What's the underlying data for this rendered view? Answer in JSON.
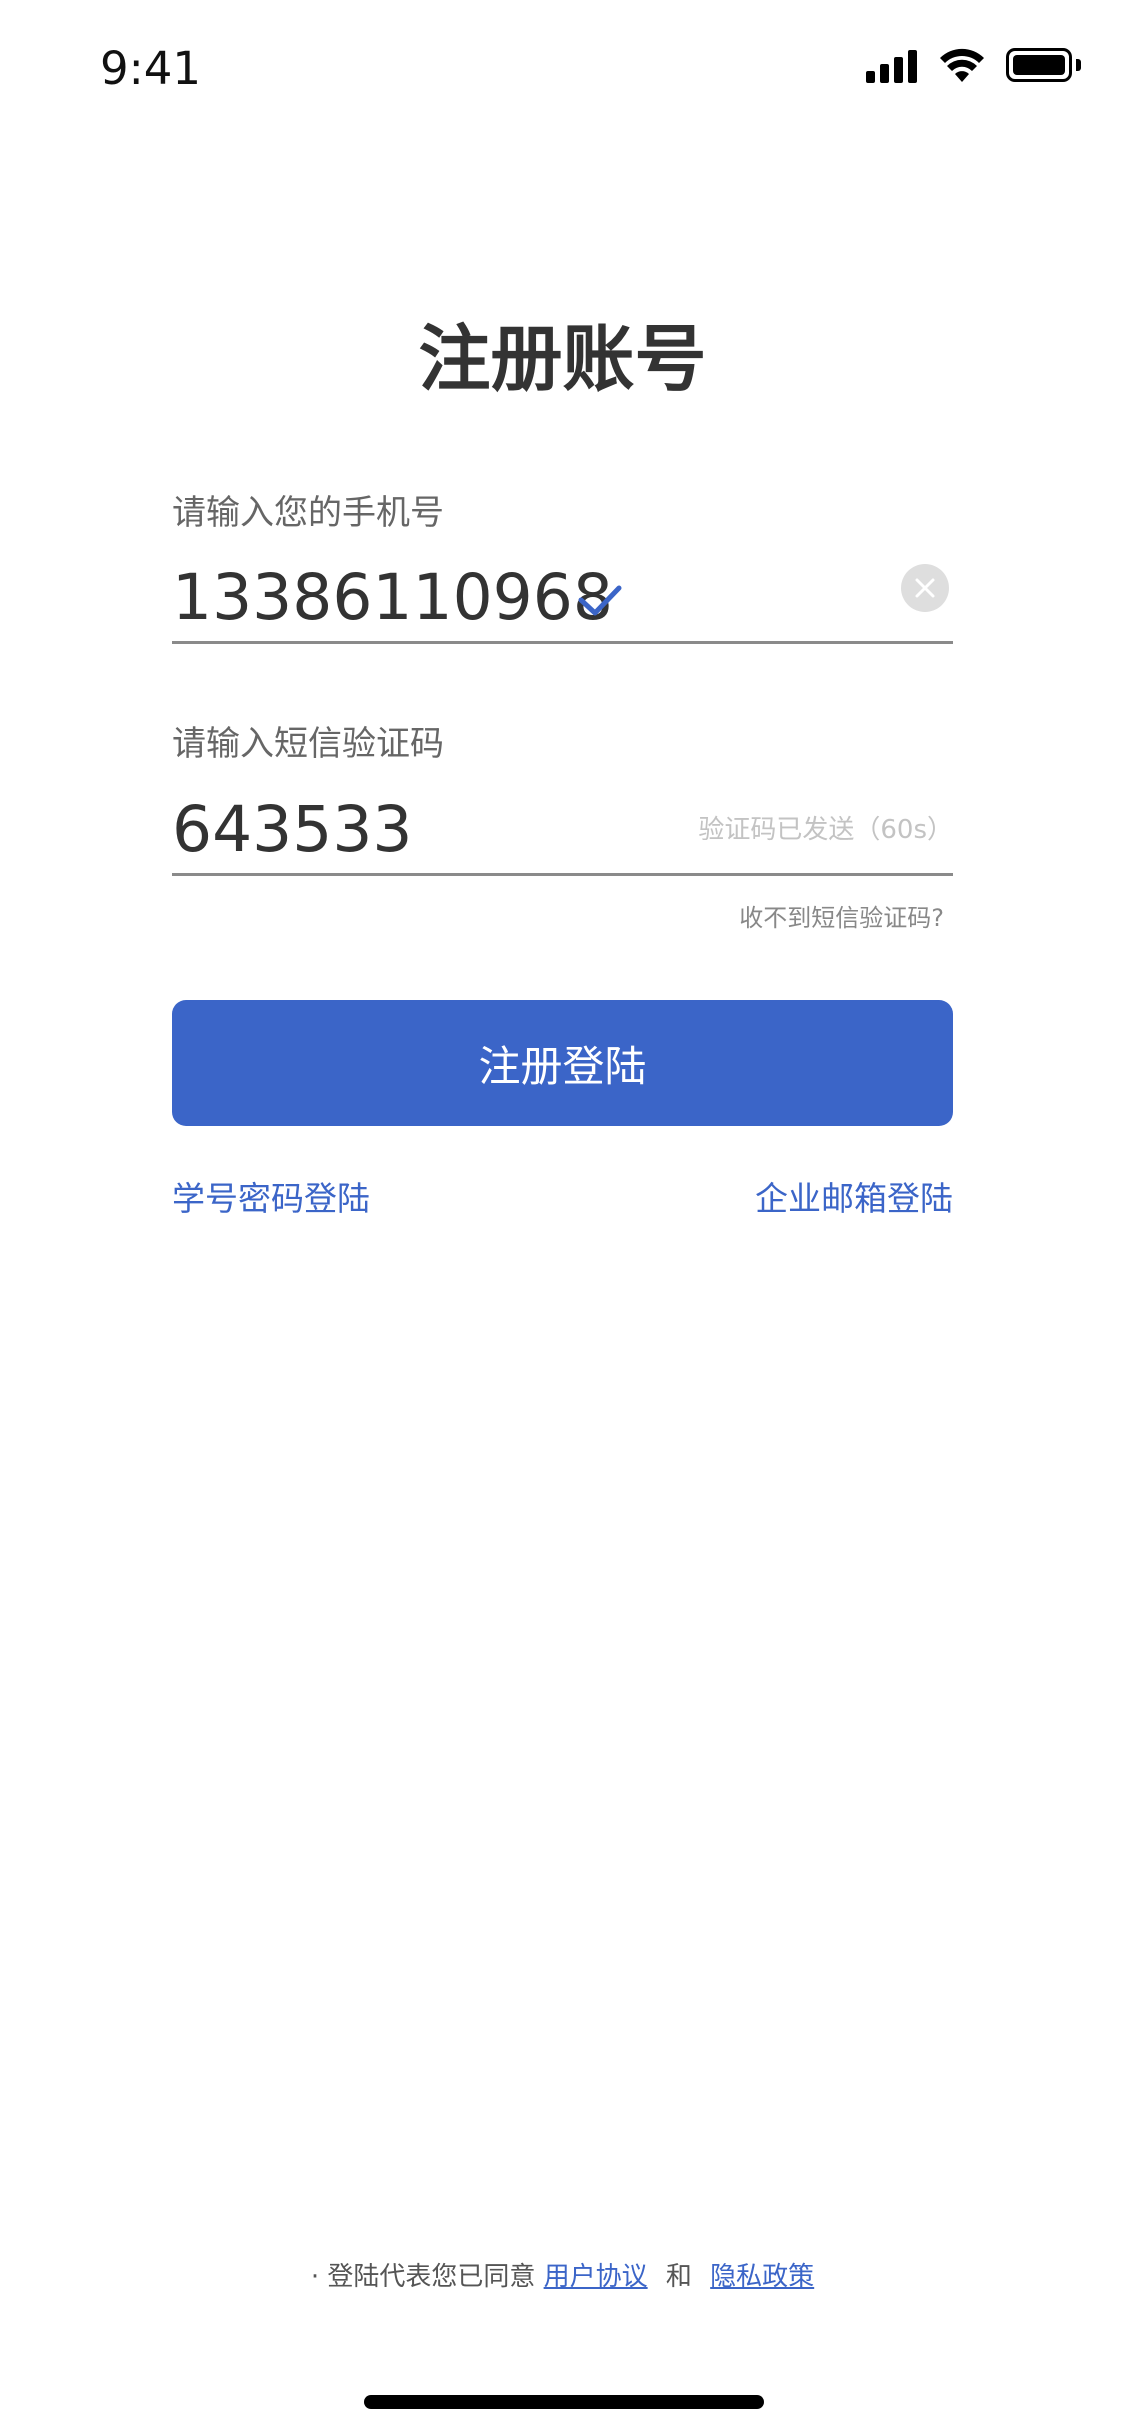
{
  "status_bar": {
    "time": "9:41",
    "icons": [
      "cellular-signal-icon",
      "wifi-icon",
      "battery-icon"
    ]
  },
  "page": {
    "title": "注册账号"
  },
  "phone_field": {
    "label": "请输入您的手机号",
    "value": "13386110968",
    "valid_icon": "check-icon",
    "clear_icon": "clear-icon"
  },
  "code_field": {
    "label": "请输入短信验证码",
    "value": "643533",
    "hint": "验证码已发送（60s）"
  },
  "resend_link": "收不到短信验证码?",
  "primary_button": {
    "label": "注册登陆"
  },
  "alt_logins": {
    "student": "学号密码登陆",
    "enterprise": "企业邮箱登陆"
  },
  "agreement": {
    "prefix": "· 登陆代表您已同意",
    "terms": "用户协议",
    "and": "和",
    "privacy": "隐私政策"
  },
  "colors": {
    "accent": "#3b65c8",
    "text": "#333333",
    "muted": "#666666",
    "hint": "#c3c3c3"
  }
}
